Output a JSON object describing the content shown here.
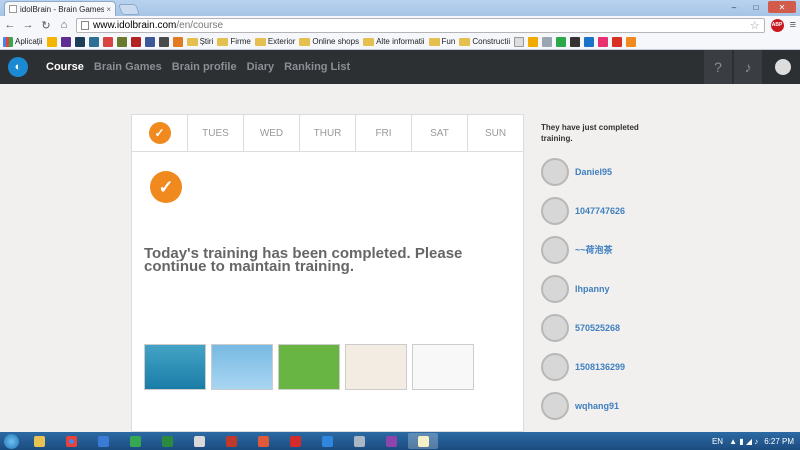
{
  "browser": {
    "tab_title": "idolBrain - Brain Games &",
    "url_host": "www.idolbrain.com",
    "url_path": "/en/course",
    "abp_label": "ABP",
    "bookmarks": [
      {
        "label": "Aplicații",
        "icon": "apps-icon"
      },
      {
        "label": "Știri",
        "icon": "folder-icon"
      },
      {
        "label": "Firme",
        "icon": "folder-icon"
      },
      {
        "label": "Exterior",
        "icon": "folder-icon"
      },
      {
        "label": "Online shops",
        "icon": "folder-icon"
      },
      {
        "label": "Alte informatii",
        "icon": "folder-icon"
      },
      {
        "label": "Fun",
        "icon": "folder-icon"
      },
      {
        "label": "Constructii",
        "icon": "folder-icon"
      }
    ]
  },
  "header": {
    "nav": [
      "Course",
      "Brain Games",
      "Brain profile",
      "Diary",
      "Ranking List"
    ],
    "help_label": "?"
  },
  "week": {
    "days": [
      "TUES",
      "WED",
      "THUR",
      "FRI",
      "SAT",
      "SUN"
    ]
  },
  "main": {
    "message": "Today's training has been completed. Please continue to maintain training."
  },
  "sidebar": {
    "title": "They have just completed training.",
    "users": [
      "Daniel95",
      "1047747626",
      "~~荷泡茶",
      "lhpanny",
      "570525268",
      "1508136299",
      "wqhang91"
    ]
  },
  "taskbar": {
    "language": "EN",
    "time": "6:27 PM"
  },
  "colors": {
    "accent_orange": "#f08a1f",
    "header_bg": "#2d3033",
    "link_blue": "#3f7fbf"
  }
}
